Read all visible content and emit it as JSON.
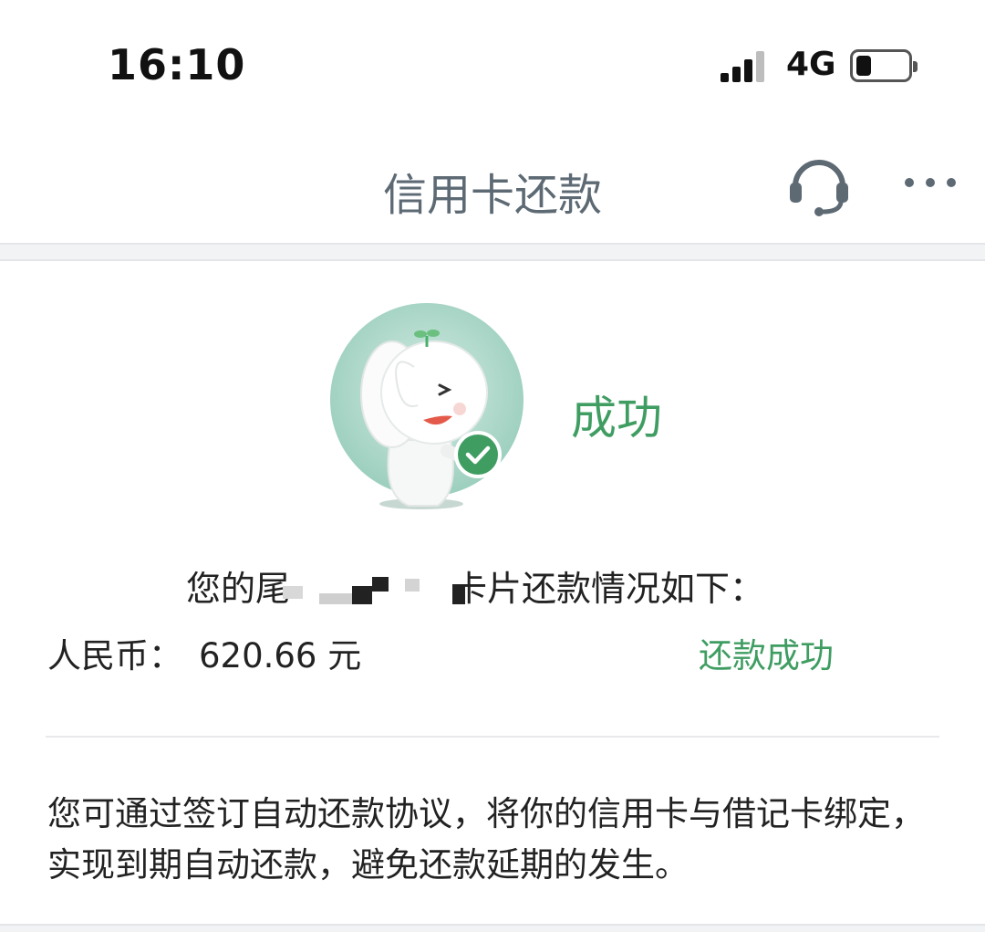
{
  "status_bar": {
    "time": "16:10",
    "network": "4G",
    "battery_level_fraction": 0.3
  },
  "nav": {
    "title": "信用卡还款",
    "icons": [
      "headset-icon",
      "more-icon"
    ],
    "color": "#5d6a74"
  },
  "result": {
    "text": "成功",
    "color": "#3f9d62",
    "mascot": "elephant-mascot-icon"
  },
  "card_info": {
    "prefix": "您的尾",
    "suffix": "卡片还款情况如下："
  },
  "amount": {
    "currency_label": "人民币：",
    "value": "620.66 元",
    "status": "还款成功"
  },
  "tip": {
    "text": "您可通过签订自动还款协议，将你的信用卡与借记卡绑定，实现到期自动还款，避免还款延期的发生。"
  }
}
